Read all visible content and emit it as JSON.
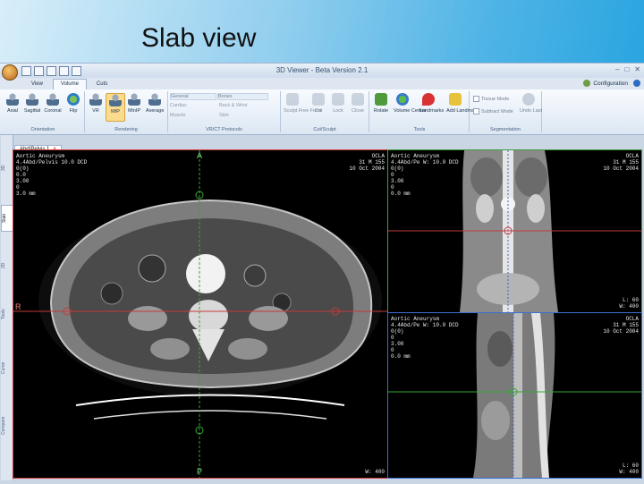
{
  "slide": {
    "title": "Slab view"
  },
  "window": {
    "title": "3D Viewer - Beta Version 2.1",
    "controls": [
      "–",
      "□",
      "✕"
    ]
  },
  "ribbon_tabs": [
    "View",
    "Volume",
    "Cuts"
  ],
  "active_tab": "Volume",
  "configuration_label": "Configuration",
  "ribbon": {
    "orientation": {
      "label": "Orientation",
      "buttons": [
        "Axial",
        "Sagittal",
        "Coronal",
        "Flip"
      ]
    },
    "rendering": {
      "label": "Rendering",
      "buttons": [
        "VR",
        "MIP",
        "MinIP",
        "Average"
      ],
      "active": "MIP"
    },
    "tissue": {
      "label": "VR/CT Protocols",
      "items": [
        "General",
        "Bones",
        "Cardiac",
        "Back & Wrist",
        "Muscle",
        "Skin"
      ]
    },
    "cut_sculpt": {
      "label": "Cut/Sculpt",
      "buttons": [
        "Sculpt Free Form",
        "Cut",
        "Lock",
        "Close"
      ]
    },
    "tools": {
      "label": "Tools",
      "buttons": [
        "Rotate",
        "Volume Center",
        "Landmarks",
        "Add Landmark"
      ]
    },
    "segmentation": {
      "label": "Segmentation",
      "checks": [
        "Tissue Mode",
        "Subtract Mode"
      ],
      "button": "Undo Last"
    }
  },
  "side_tabs": [
    "3D",
    "Slab",
    "2D",
    "Tools",
    "Curve",
    "Compare"
  ],
  "active_side_tab": "Slab",
  "view_tab": {
    "label": "Abd/Pelvis 1"
  },
  "viewports": {
    "axial": {
      "top_left": "Aortic Aneurysm\n4.4Abd/Pelvis 10.0 DCD\n0(0)\n0.0\n3.00\n0\n3.0 mm",
      "top_right": "OCLA\n31 M 155\n10 Oct 2004",
      "bottom_right": "W: 400",
      "orient_left": "R",
      "orient_bottom": "P",
      "orient_top": "A"
    },
    "coronal": {
      "top_left": "Aortic Aneurysm\n4.4Abd/Pe W: 10.0 DCD\n0(0)\n0\n3.00\n0\n0.0 mm",
      "top_right": "OCLA\n31 M 155\n10 Oct 2004",
      "bottom_right": "L: 60\nW: 400"
    },
    "sagittal": {
      "top_left": "Aortic Aneurysm\n4.4Abd/Pe W: 10.0 DCD\n0(0)\n0\n3.00\n0\n0.0 mm",
      "top_right": "OCLA\n31 M 155\n10 Oct 2004",
      "bottom_right": "L: 60\nW: 400"
    }
  },
  "colors": {
    "axial_frame": "#d43b3b",
    "coronal_frame": "#3ea23e",
    "sagittal_frame": "#3a6fd0",
    "active_tool": "#fbdc8e"
  }
}
